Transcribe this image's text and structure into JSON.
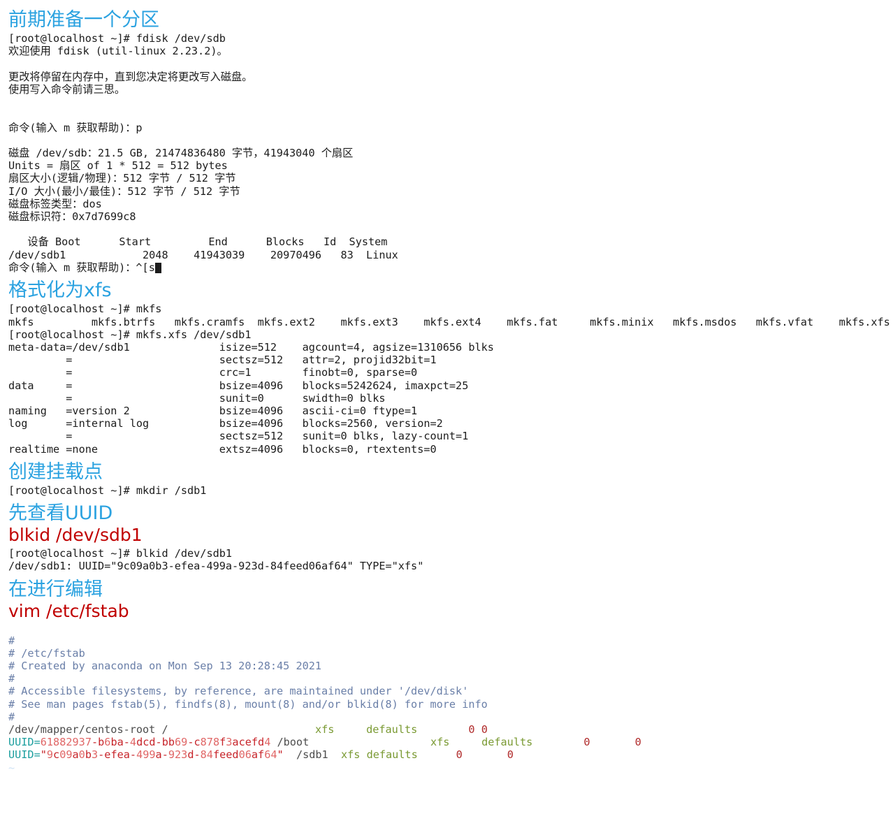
{
  "document": {
    "language": "zh-CN",
    "colors": {
      "heading_blue": "#2ba2e0",
      "heading_red": "#c00000",
      "terminal_text": "#1c1c1c",
      "vim_comment": "#6a7fa8",
      "vim_uuid_key": "#1b9e9e",
      "vim_hex_alpha": "#c7242a",
      "vim_hex_num": "#e06666",
      "vim_fstype": "#7a9a33",
      "vim_number": "#b02a2a",
      "page_background": "#ffffff"
    }
  },
  "sections": {
    "prepare_partition": {
      "title": "前期准备一个分区",
      "lines": [
        "[root@localhost ~]# fdisk /dev/sdb",
        "欢迎使用 fdisk (util-linux 2.23.2)。",
        "",
        "更改将停留在内存中，直到您决定将更改写入磁盘。",
        "使用写入命令前请三思。",
        "",
        "",
        "命令(输入 m 获取帮助)：p",
        "",
        "磁盘 /dev/sdb：21.5 GB, 21474836480 字节，41943040 个扇区",
        "Units = 扇区 of 1 * 512 = 512 bytes",
        "扇区大小(逻辑/物理)：512 字节 / 512 字节",
        "I/O 大小(最小/最佳)：512 字节 / 512 字节",
        "磁盘标签类型：dos",
        "磁盘标识符：0x7d7699c8",
        "",
        "   设备 Boot      Start         End      Blocks   Id  System",
        "/dev/sdb1            2048    41943039    20970496   83  Linux",
        ""
      ],
      "prompt_tail": {
        "text": "命令(输入 m 获取帮助)：^[s",
        "cursor": "block"
      }
    },
    "format_xfs": {
      "title": "格式化为xfs",
      "lines": [
        "[root@localhost ~]# mkfs",
        "mkfs         mkfs.btrfs   mkfs.cramfs  mkfs.ext2    mkfs.ext3    mkfs.ext4    mkfs.fat     mkfs.minix   mkfs.msdos   mkfs.vfat    mkfs.xfs",
        "[root@localhost ~]# mkfs.xfs /dev/sdb1",
        "meta-data=/dev/sdb1              isize=512    agcount=4, agsize=1310656 blks",
        "         =                       sectsz=512   attr=2, projid32bit=1",
        "         =                       crc=1        finobt=0, sparse=0",
        "data     =                       bsize=4096   blocks=5242624, imaxpct=25",
        "         =                       sunit=0      swidth=0 blks",
        "naming   =version 2              bsize=4096   ascii-ci=0 ftype=1",
        "log      =internal log           bsize=4096   blocks=2560, version=2",
        "         =                       sectsz=512   sunit=0 blks, lazy-count=1",
        "realtime =none                   extsz=4096   blocks=0, rtextents=0"
      ]
    },
    "create_mountpoint": {
      "title": "创建挂载点",
      "lines": [
        "[root@localhost ~]# mkdir /sdb1"
      ]
    },
    "check_uuid": {
      "title": "先查看UUID",
      "command": "blkid /dev/sdb1",
      "lines": [
        "[root@localhost ~]# blkid /dev/sdb1",
        "/dev/sdb1: UUID=\"9c09a0b3-efea-499a-923d-84feed06af64\" TYPE=\"xfs\""
      ]
    },
    "edit_fstab": {
      "title": "在进行编辑",
      "command": "vim /etc/fstab",
      "fstab": {
        "comments": [
          "#",
          "# /etc/fstab",
          "# Created by anaconda on Mon Sep 13 20:28:45 2021",
          "#",
          "# Accessible filesystems, by reference, are maintained under '/dev/disk'",
          "# See man pages fstab(5), findfs(8), mount(8) and/or blkid(8) for more info",
          "#"
        ],
        "entries": [
          {
            "device": "/dev/mapper/centos-root",
            "mountpoint": "/",
            "fstype": "xfs",
            "options": "defaults",
            "dump": "0",
            "pass": "0",
            "raw": "/dev/mapper/centos-root /                       xfs     defaults        0 0"
          },
          {
            "device": "UUID=61882937-b6ba-4dcd-bb69-c878f3acefd4",
            "uuid_key": "UUID=",
            "uuid_value": "61882937-b6ba-4dcd-bb69-c878f3acefd4",
            "mountpoint": "/boot",
            "fstype": "xfs",
            "options": "defaults",
            "dump": "0",
            "pass": "0",
            "raw": "UUID=61882937-b6ba-4dcd-bb69-c878f3acefd4 /boot                   xfs     defaults        0       0"
          },
          {
            "device": "UUID=\"9c09a0b3-efea-499a-923d-84feed06af64\"",
            "uuid_key": "UUID=",
            "uuid_value": "\"9c09a0b3-efea-499a-923d-84feed06af64\"",
            "mountpoint": "/sdb1",
            "fstype": "xfs",
            "options": "defaults",
            "dump": "0",
            "pass": "0",
            "raw": "UUID=\"9c09a0b3-efea-499a-923d-84feed06af64\"  /sdb1  xfs defaults      0       0"
          }
        ],
        "empty_marker": "~"
      }
    }
  }
}
